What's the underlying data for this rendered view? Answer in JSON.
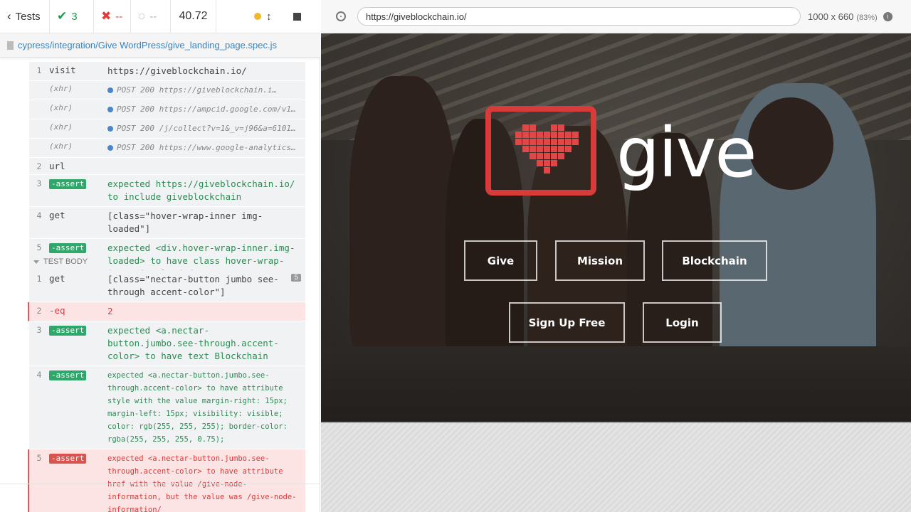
{
  "stats": {
    "tests_label": "Tests",
    "passed": "3",
    "failed": "--",
    "pending": "--",
    "duration": "40.72"
  },
  "spec_path": "cypress/integration/Give WordPress/give_landing_page.spec.js",
  "commands": [
    {
      "num": "1",
      "name": "visit",
      "msg": "https://giveblockchain.io/"
    },
    {
      "num": "",
      "name": "(xhr)",
      "msg": "POST 200 https://giveblockchain.i…"
    },
    {
      "num": "",
      "name": "(xhr)",
      "msg": "POST 200 https://ampcid.google.com/v1/pu…"
    },
    {
      "num": "",
      "name": "(xhr)",
      "msg": "POST 200 /j/collect?v=1&_v=j96&a=6101906…"
    },
    {
      "num": "",
      "name": "(xhr)",
      "msg": "POST 200 https://www.google-analytics.co…"
    },
    {
      "num": "2",
      "name": "url",
      "msg": ""
    },
    {
      "num": "3",
      "name": "-assert",
      "msg": "expected https://giveblockchain.io/ to include giveblockchain"
    },
    {
      "num": "4",
      "name": "get",
      "msg": "[class=\"hover-wrap-inner img-loaded\"]"
    },
    {
      "num": "5",
      "name": "-assert",
      "msg": "expected <div.hover-wrap-inner.img-loaded> to have class hover-wrap-inner img-loaded"
    }
  ],
  "section_title": "TEST BODY",
  "body_commands": [
    {
      "num": "1",
      "name": "get",
      "msg": "[class=\"nectar-button jumbo see-through accent-color\"]",
      "count": "5"
    },
    {
      "num": "2",
      "name": "-eq",
      "msg": "2"
    },
    {
      "num": "3",
      "name": "-assert",
      "msg": "expected <a.nectar-button.jumbo.see-through.accent-color> to have text Blockchain"
    },
    {
      "num": "4",
      "name": "-assert",
      "msg": "expected <a.nectar-button.jumbo.see-through.accent-color> to have attribute style with the value margin-right: 15px; margin-left: 15px; visibility: visible; color: rgb(255, 255, 255); border-color: rgba(255, 255, 255, 0.75);"
    },
    {
      "num": "5",
      "name": "-assert",
      "msg": "expected <a.nectar-button.jumbo.see-through.accent-color> to have attribute href with the value /give-node-information, but the value was /give-node-information/"
    }
  ],
  "url": "https://giveblockchain.io/",
  "viewport": "1000 x 660",
  "scale": "(83%)",
  "site": {
    "brand": "give",
    "buttons": [
      "Give",
      "Mission",
      "Blockchain",
      "Sign Up Free",
      "Login"
    ]
  },
  "colors": {
    "pass": "#1a9b52",
    "fail": "#e03c3c",
    "brand_red": "#d93a3a"
  }
}
